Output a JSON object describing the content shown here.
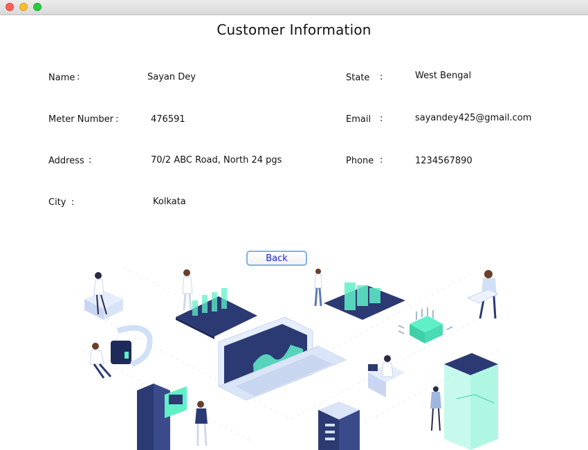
{
  "window": {
    "traffic_lights": [
      "close",
      "minimize",
      "zoom"
    ]
  },
  "page": {
    "title": "Customer Information"
  },
  "fields": {
    "name": {
      "label": "Name",
      "colon": ":",
      "value": "Sayan Dey"
    },
    "meter_number": {
      "label": "Meter Number",
      "colon": ":",
      "value": "476591"
    },
    "address": {
      "label": "Address",
      "colon": ":",
      "value": "70/2 ABC Road, North 24 pgs"
    },
    "city": {
      "label": "City",
      "colon": ":",
      "value": "Kolkata"
    },
    "state": {
      "label": "State",
      "colon": ":",
      "value": "West Bengal"
    },
    "email": {
      "label": "Email",
      "colon": ":",
      "value": "sayandey425@gmail.com"
    },
    "phone": {
      "label": "Phone",
      "colon": ":",
      "value": "1234567890"
    }
  },
  "actions": {
    "back_label": "Back"
  },
  "colors": {
    "accent_teal": "#5ff0c8",
    "navy": "#2c3a73",
    "button_text": "#1a1ad6",
    "button_border": "#7fb1ec"
  },
  "illustration": {
    "icon": "isometric-tech-people-illustration"
  }
}
